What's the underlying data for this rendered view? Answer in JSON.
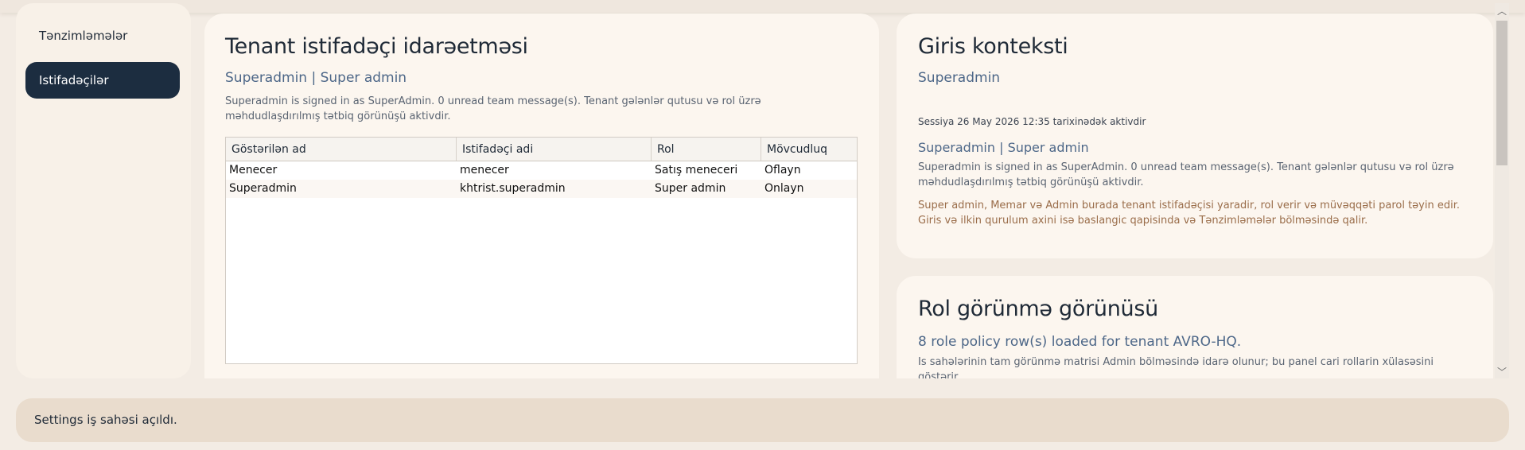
{
  "sidebar": {
    "items": [
      {
        "label": "Tənzimləmələr",
        "active": false
      },
      {
        "label": "Istifadəçilər",
        "active": true
      }
    ]
  },
  "main": {
    "title": "Tenant istifadəçi idarəetməsi",
    "subtitle": "Superadmin | Super admin",
    "description": "Superadmin is signed in as SuperAdmin. 0 unread team message(s). Tenant gələnlər qutusu və rol üzrə məhdudlaşdırılmış tətbiq görünüşü aktivdir.",
    "table": {
      "columns": [
        "Göstərilən ad",
        "Istifadəçi adi",
        "Rol",
        "Mövcudluq"
      ],
      "rows": [
        [
          "Menecer",
          "menecer",
          "Satış meneceri",
          "Oflayn"
        ],
        [
          "Superadmin",
          "khtrist.superadmin",
          "Super admin",
          "Onlayn"
        ]
      ]
    }
  },
  "context_card": {
    "title": "Giris konteksti",
    "user": "Superadmin",
    "session": "Sessiya 26 May 2026 12:35 tarixinədək aktivdir",
    "role_line": "Superadmin | Super admin",
    "description": "Superadmin is signed in as SuperAdmin. 0 unread team message(s). Tenant gələnlər qutusu və rol üzrə məhdudlaşdırılmış tətbiq görünüşü aktivdir.",
    "note": "Super admin, Memar və Admin burada tenant istifadəçisi yaradir, rol verir və müvəqqəti parol təyin edir. Giris və ilkin qurulum axini isə baslangic qapisinda və Tənzimləmələr bölməsində qalir."
  },
  "role_card": {
    "title": "Rol görünmə görünüsü",
    "subtitle": "8 role policy row(s) loaded for tenant AVRO-HQ.",
    "description": "Is sahələrinin tam görünmə matrisi Admin bölməsində idarə olunur; bu panel cari rollarin xülasəsini göstərir."
  },
  "status": {
    "message": "Settings iş sahəsi açıldı."
  },
  "colors": {
    "background": "#f3ece4",
    "panel": "#fcf6ef",
    "active_nav": "#1c2d40",
    "accent_text": "#4d6788",
    "warning_text": "#9a6d4a",
    "status_bar": "#e9dccd"
  }
}
